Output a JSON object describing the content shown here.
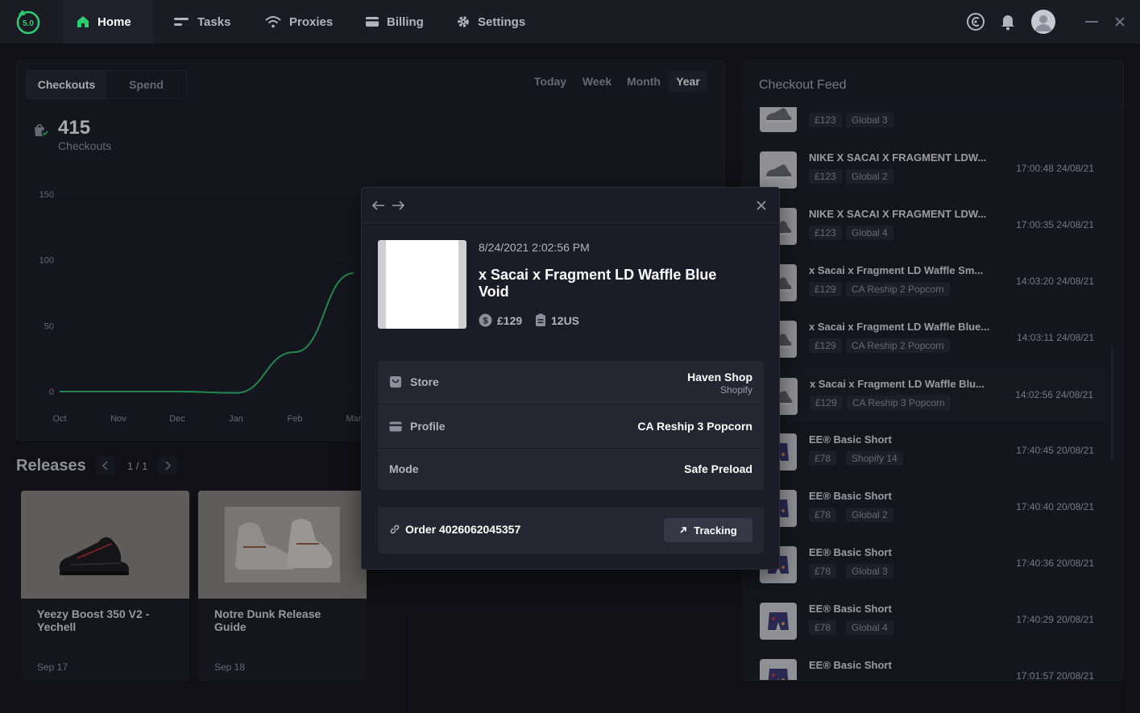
{
  "app": {
    "version": "5.0"
  },
  "nav": {
    "home": "Home",
    "tasks": "Tasks",
    "proxies": "Proxies",
    "billing": "Billing",
    "settings": "Settings"
  },
  "dashboard": {
    "segments": [
      "Checkouts",
      "Spend"
    ],
    "ranges": [
      "Today",
      "Week",
      "Month",
      "Year"
    ],
    "selected_range": "Year",
    "checkouts_count": "415",
    "checkouts_label": "Checkouts"
  },
  "chart_data": {
    "type": "line",
    "categories": [
      "Oct",
      "Nov",
      "Dec",
      "Jan",
      "Feb",
      "Mar"
    ],
    "values": [
      0,
      0,
      0,
      -1,
      30,
      90
    ],
    "y_ticks": [
      0,
      50,
      100,
      150
    ],
    "ylim": [
      0,
      150
    ],
    "line_color": "#2ecc71"
  },
  "releases": {
    "title": "Releases",
    "pager": "1 / 1",
    "items": [
      {
        "name": "Yeezy Boost 350 V2 - Yechell",
        "date": "Sep 17"
      },
      {
        "name": "Notre Dunk Release Guide",
        "date": "Sep 18"
      }
    ]
  },
  "feed": {
    "title": "Checkout Feed",
    "items": [
      {
        "name": "",
        "price": "£123",
        "profile": "Global 3",
        "time": ""
      },
      {
        "name": "NIKE X SACAI X FRAGMENT LDW...",
        "price": "£123",
        "profile": "Global 2",
        "time": "17:00:48 24/08/21"
      },
      {
        "name": "NIKE X SACAI X FRAGMENT LDW...",
        "price": "£123",
        "profile": "Global 4",
        "time": "17:00:35 24/08/21"
      },
      {
        "name": "x Sacai x Fragment LD Waffle Sm...",
        "price": "£129",
        "profile": "CA Reship 2 Popcorn",
        "time": "14:03:20 24/08/21"
      },
      {
        "name": "x Sacai x Fragment LD Waffle Blue...",
        "price": "£129",
        "profile": "CA Reship 2 Popcorn",
        "time": "14:03:11 24/08/21"
      },
      {
        "name": "x Sacai x Fragment LD Waffle Blu...",
        "price": "£129",
        "profile": "CA Reship 3 Popcorn",
        "time": "14:02:56 24/08/21"
      },
      {
        "name": "EE® Basic Short",
        "price": "£78",
        "profile": "Shopify 14",
        "time": "17:40:45 20/08/21"
      },
      {
        "name": "EE® Basic Short",
        "price": "£78",
        "profile": "Global 2",
        "time": "17:40:40 20/08/21"
      },
      {
        "name": "EE® Basic Short",
        "price": "£78",
        "profile": "Global 3",
        "time": "17:40:36 20/08/21"
      },
      {
        "name": "EE® Basic Short",
        "price": "£78",
        "profile": "Global 4",
        "time": "17:40:29 20/08/21"
      },
      {
        "name": "EE® Basic Short",
        "price": "",
        "profile": "",
        "time": "17:01:57 20/08/21"
      }
    ]
  },
  "modal": {
    "date": "8/24/2021 2:02:56 PM",
    "title": "x Sacai x Fragment LD Waffle Blue Void",
    "price": "£129",
    "size": "12US",
    "store_label": "Store",
    "store_value": "Haven Shop",
    "store_platform": "Shopify",
    "profile_label": "Profile",
    "profile_value": "CA Reship 3 Popcorn",
    "mode_label": "Mode",
    "mode_value": "Safe Preload",
    "order_text": "Order 4026062045357",
    "tracking_label": "Tracking"
  },
  "colors": {
    "accent": "#2ecc71",
    "background": "#14141b",
    "panel": "#1c1c26"
  }
}
